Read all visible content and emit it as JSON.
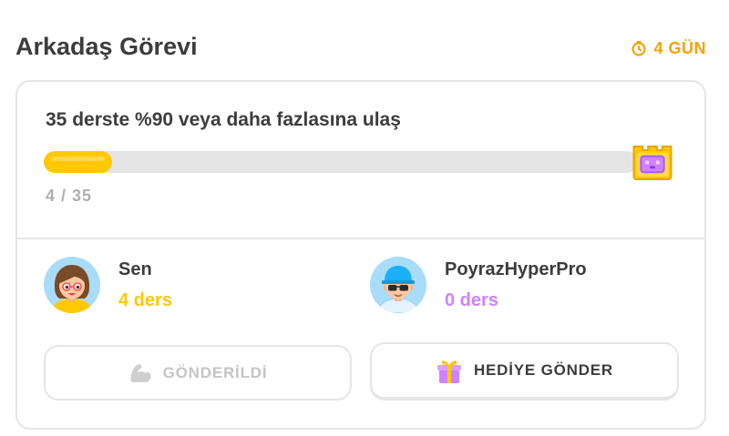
{
  "header": {
    "title": "Arkadaş Görevi",
    "time_left": "4 GÜN",
    "time_icon": "clock-icon"
  },
  "quest": {
    "goal": "35 derste %90 veya daha fazlasına ulaş",
    "progress": {
      "current": 4,
      "total": 35,
      "label": "4 / 35"
    },
    "reward_icon": "chest-icon"
  },
  "participants": [
    {
      "name": "Sen",
      "lessons": "4 ders",
      "avatar": "girl-avatar"
    },
    {
      "name": "PoyrazHyperPro",
      "lessons": "0 ders",
      "avatar": "boy-cap-sunglasses-avatar"
    }
  ],
  "actions": {
    "sent": {
      "label": "GÖNDERİLDİ",
      "icon": "flexed-bicep-icon",
      "disabled": true
    },
    "gift": {
      "label": "HEDİYE GÖNDER",
      "icon": "gift-icon"
    }
  },
  "colors": {
    "text": "#3c3c3c",
    "muted": "#afafaf",
    "timer": "#f5a300",
    "border": "#e5e5e5",
    "progress_track": "#e5e5e5",
    "progress_fill": "#ffc800",
    "you": "#ffc800",
    "friend": "#ce82ff",
    "disabled": "#c4c4c4"
  }
}
